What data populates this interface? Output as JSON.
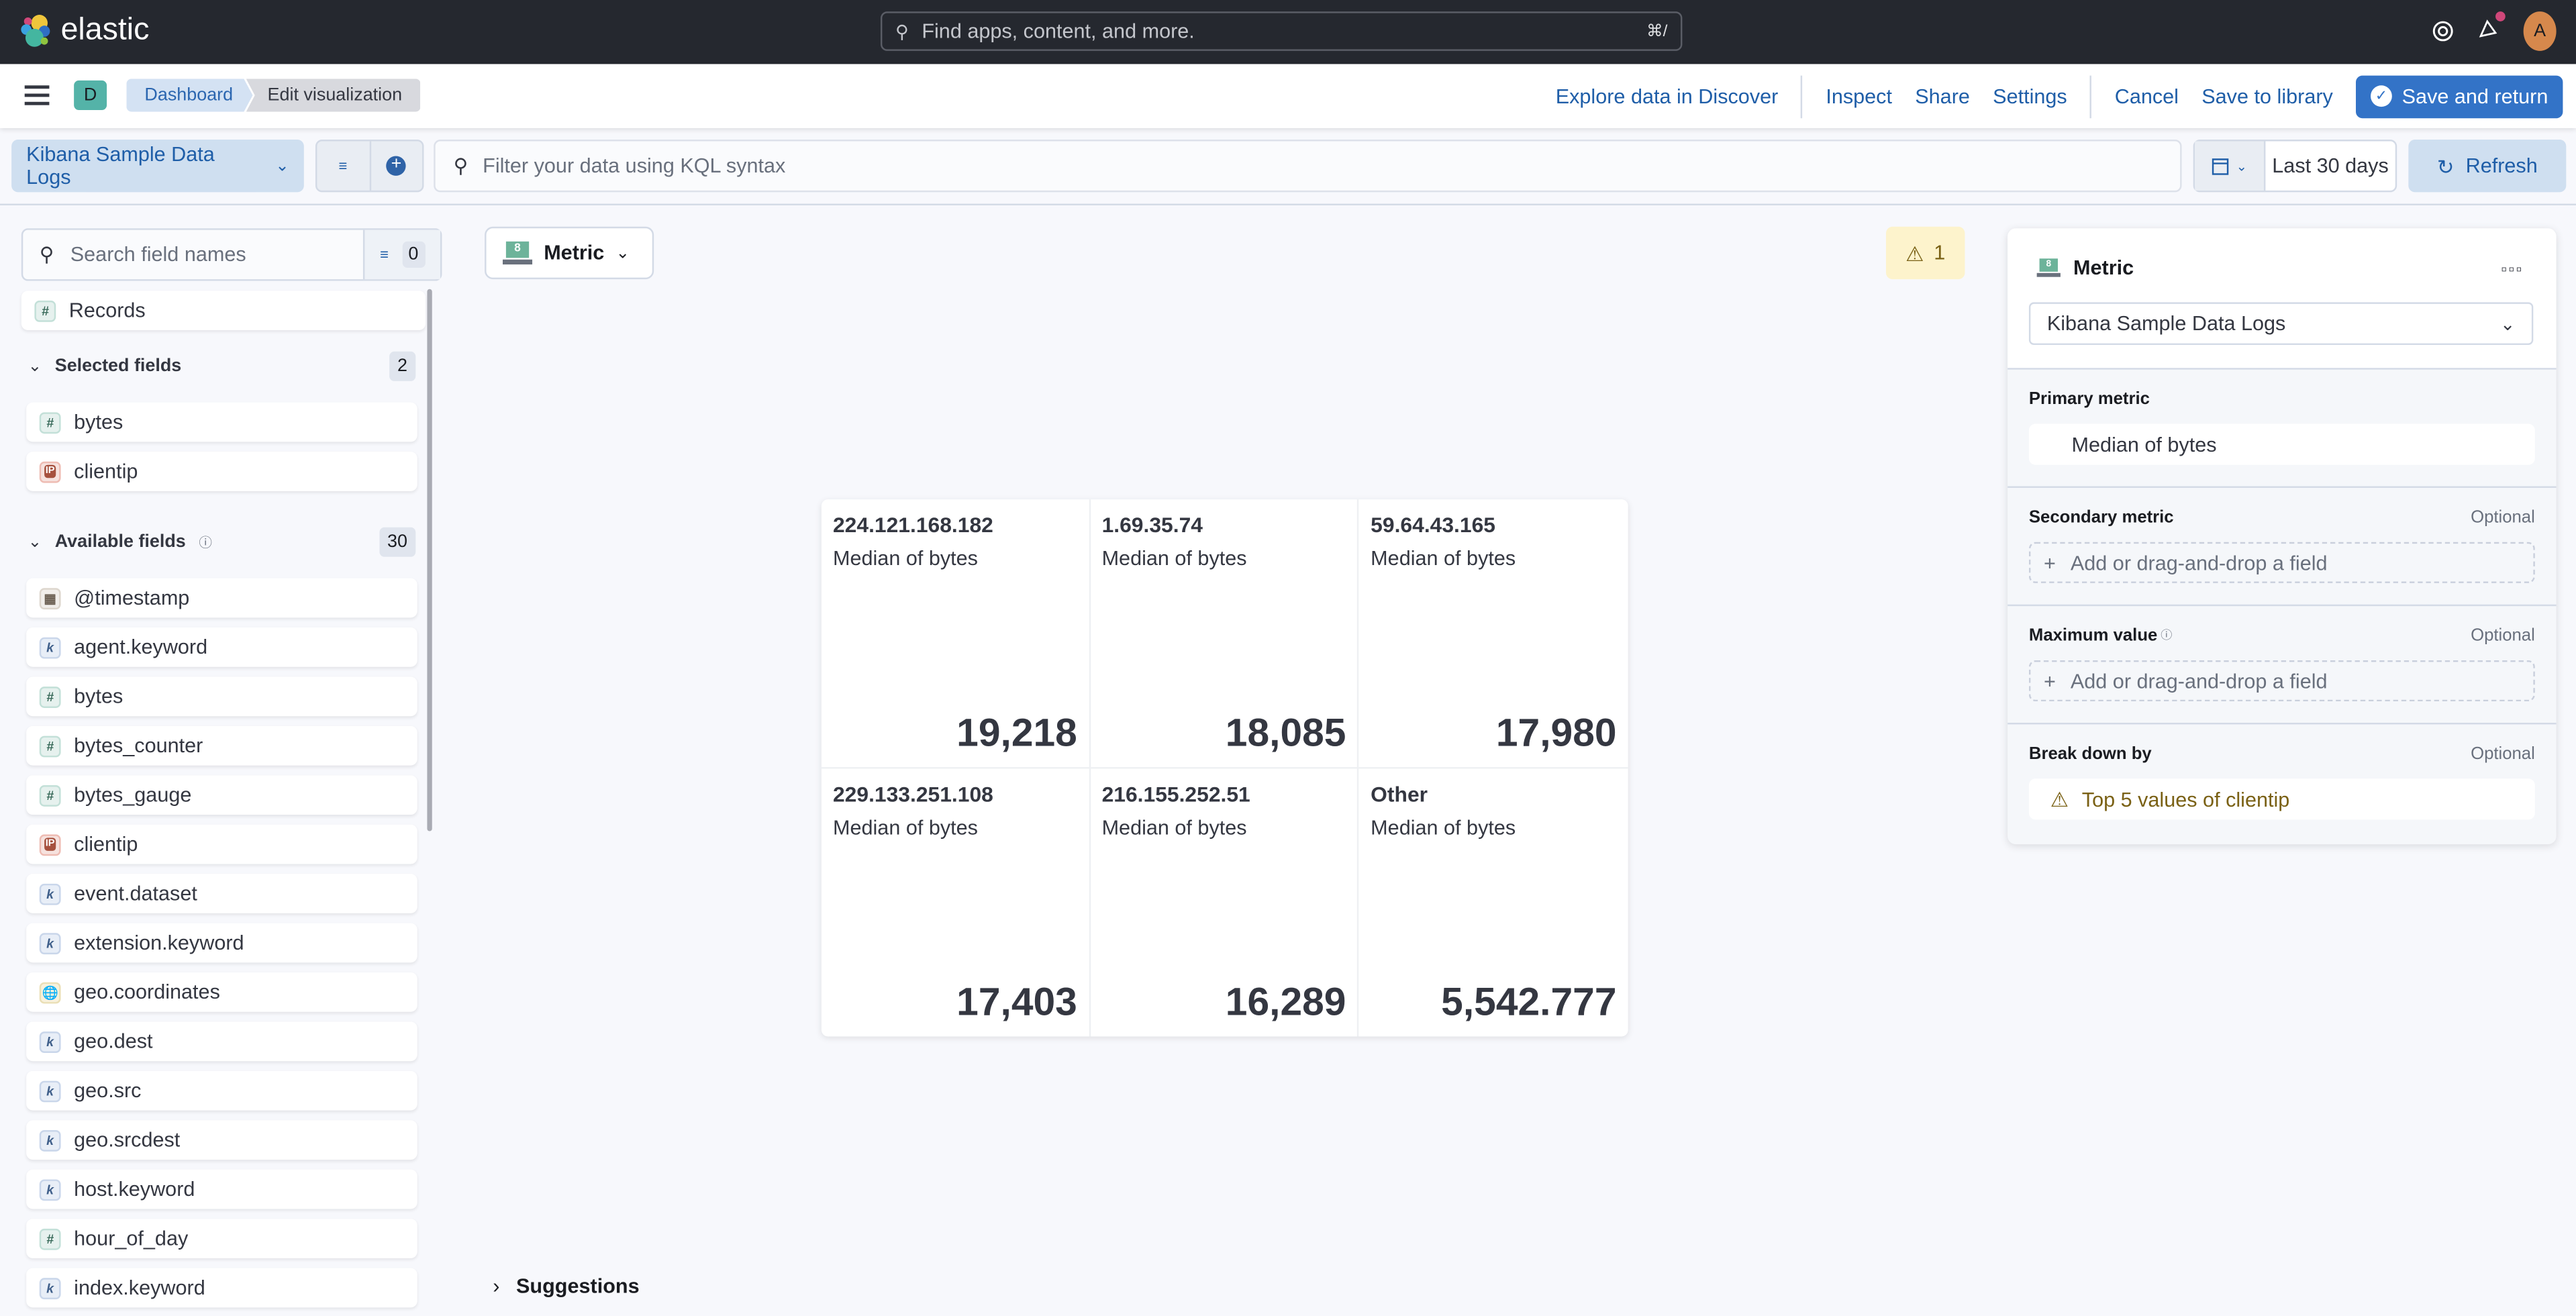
{
  "header": {
    "brand": "elastic",
    "global_search_placeholder": "Find apps, content, and more.",
    "global_search_shortcut": "⌘/",
    "avatar_initial": "A",
    "icons": [
      "help-icon",
      "newsfeed-icon",
      "user-avatar"
    ]
  },
  "nav": {
    "space_initial": "D",
    "breadcrumbs": [
      "Dashboard",
      "Edit visualization"
    ],
    "actions": {
      "explore": "Explore data in Discover",
      "inspect": "Inspect",
      "share": "Share",
      "settings": "Settings",
      "cancel": "Cancel",
      "save_library": "Save to library",
      "save_return": "Save and return"
    }
  },
  "query": {
    "data_view": "Kibana Sample Data Logs",
    "kql_placeholder": "Filter your data using KQL syntax",
    "time_range": "Last 30 days",
    "refresh": "Refresh"
  },
  "fields": {
    "search_placeholder": "Search field names",
    "filter_count": "0",
    "records_label": "Records",
    "selected": {
      "label": "Selected fields",
      "count": "2",
      "items": [
        {
          "name": "bytes",
          "type": "number"
        },
        {
          "name": "clientip",
          "type": "ip"
        }
      ]
    },
    "available": {
      "label": "Available fields",
      "count": "30",
      "items": [
        {
          "name": "@timestamp",
          "type": "date"
        },
        {
          "name": "agent.keyword",
          "type": "keyword"
        },
        {
          "name": "bytes",
          "type": "number"
        },
        {
          "name": "bytes_counter",
          "type": "number"
        },
        {
          "name": "bytes_gauge",
          "type": "number"
        },
        {
          "name": "clientip",
          "type": "ip"
        },
        {
          "name": "event.dataset",
          "type": "keyword"
        },
        {
          "name": "extension.keyword",
          "type": "keyword"
        },
        {
          "name": "geo.coordinates",
          "type": "geo"
        },
        {
          "name": "geo.dest",
          "type": "keyword"
        },
        {
          "name": "geo.src",
          "type": "keyword"
        },
        {
          "name": "geo.srcdest",
          "type": "keyword"
        },
        {
          "name": "host.keyword",
          "type": "keyword"
        },
        {
          "name": "hour_of_day",
          "type": "number"
        },
        {
          "name": "index.keyword",
          "type": "keyword"
        }
      ]
    }
  },
  "workspace": {
    "vis_type": "Metric",
    "warning_count": "1",
    "suggestions_label": "Suggestions",
    "tiles": [
      {
        "title": "224.121.168.182",
        "subtitle": "Median of bytes",
        "value": "19,218"
      },
      {
        "title": "1.69.35.74",
        "subtitle": "Median of bytes",
        "value": "18,085"
      },
      {
        "title": "59.64.43.165",
        "subtitle": "Median of bytes",
        "value": "17,980"
      },
      {
        "title": "229.133.251.108",
        "subtitle": "Median of bytes",
        "value": "17,403"
      },
      {
        "title": "216.155.252.51",
        "subtitle": "Median of bytes",
        "value": "16,289"
      },
      {
        "title": "Other",
        "subtitle": "Median of bytes",
        "value": "5,542.777"
      }
    ]
  },
  "config": {
    "title": "Metric",
    "data_view": "Kibana Sample Data Logs",
    "sections": {
      "primary": {
        "label": "Primary metric",
        "value": "Median of bytes"
      },
      "secondary": {
        "label": "Secondary metric",
        "optional": "Optional",
        "placeholder": "Add or drag-and-drop a field"
      },
      "maximum": {
        "label": "Maximum value",
        "optional": "Optional",
        "placeholder": "Add or drag-and-drop a field"
      },
      "breakdown": {
        "label": "Break down by",
        "optional": "Optional",
        "value": "Top 5 values of clientip"
      }
    }
  },
  "colors": {
    "primary": "#3373c7",
    "header_bg": "#25282f",
    "warning_text": "#7a6115",
    "warning_bg": "#fdf3cc"
  }
}
